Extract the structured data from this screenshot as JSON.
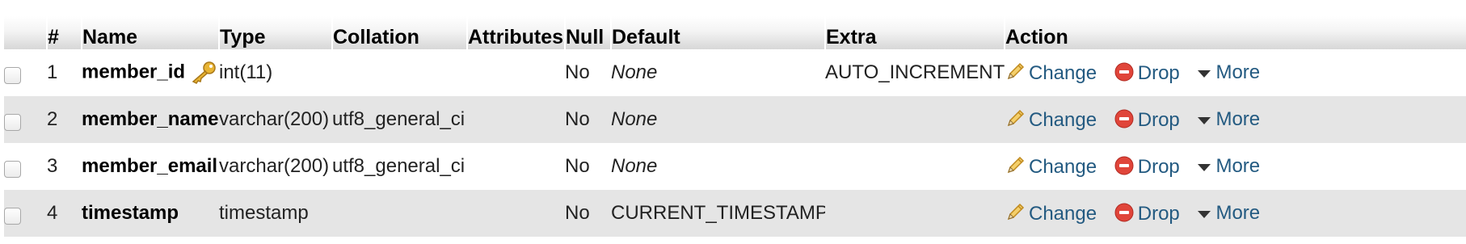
{
  "headers": {
    "num": "#",
    "name": "Name",
    "type": "Type",
    "collation": "Collation",
    "attributes": "Attributes",
    "null": "Null",
    "default": "Default",
    "extra": "Extra",
    "action": "Action"
  },
  "actions": {
    "change": "Change",
    "drop": "Drop",
    "more": "More"
  },
  "rows": [
    {
      "num": "1",
      "name": "member_id",
      "type": "int(11)",
      "collation": "",
      "attributes": "",
      "null": "No",
      "default": "None",
      "extra": "AUTO_INCREMENT"
    },
    {
      "num": "2",
      "name": "member_name",
      "type": "varchar(200)",
      "collation": "utf8_general_ci",
      "attributes": "",
      "null": "No",
      "default": "None",
      "extra": ""
    },
    {
      "num": "3",
      "name": "member_email",
      "type": "varchar(200)",
      "collation": "utf8_general_ci",
      "attributes": "",
      "null": "No",
      "default": "None",
      "extra": ""
    },
    {
      "num": "4",
      "name": "timestamp",
      "type": "timestamp",
      "collation": "",
      "attributes": "",
      "null": "No",
      "default": "CURRENT_TIMESTAMP",
      "extra": ""
    }
  ],
  "icons": {
    "primary_key": "key-icon",
    "change": "pencil-icon",
    "drop": "drop-icon",
    "more": "triangle-down-icon"
  },
  "colors": {
    "link": "#235a81",
    "row_even": "#e5e5e5",
    "drop_red": "#e0453a",
    "key_gold": "#e8b433"
  }
}
